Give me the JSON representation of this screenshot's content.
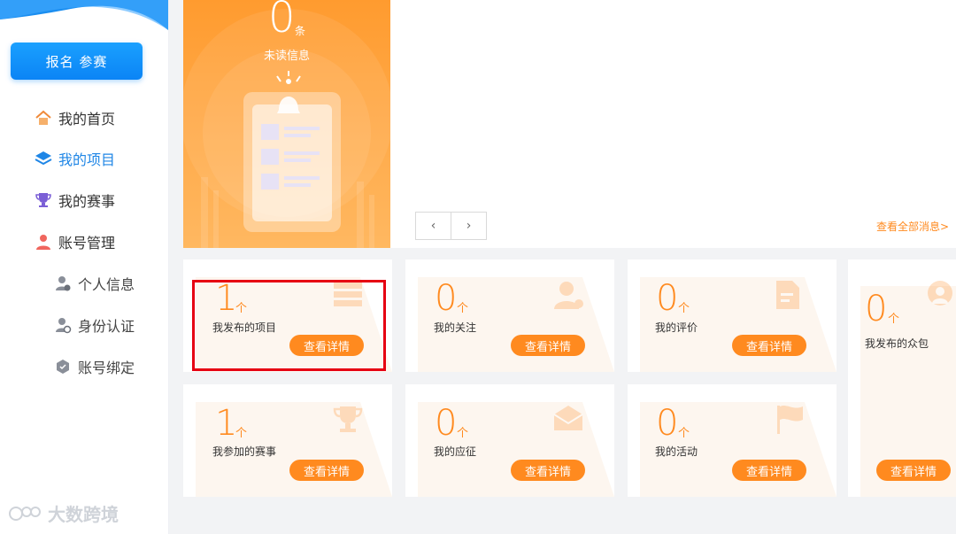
{
  "sidebar": {
    "signup_label": "报名 参赛",
    "items": [
      {
        "label": "我的首页",
        "icon": "home-icon"
      },
      {
        "label": "我的项目",
        "icon": "layers-icon",
        "active": true
      },
      {
        "label": "我的赛事",
        "icon": "trophy-icon"
      },
      {
        "label": "账号管理",
        "icon": "user-icon"
      }
    ],
    "sub_items": [
      {
        "label": "个人信息",
        "icon": "person-info-icon"
      },
      {
        "label": "身份认证",
        "icon": "id-verify-icon"
      },
      {
        "label": "账号绑定",
        "icon": "bind-icon"
      }
    ],
    "watermark": "大数跨境"
  },
  "notice": {
    "count": "0",
    "unit": "条",
    "label": "未读信息"
  },
  "messages": {
    "prev": "‹",
    "next": "›",
    "view_all": "查看全部消息>"
  },
  "cards": [
    {
      "count": "1",
      "unit": "个",
      "label": "我发布的项目",
      "button": "查看详情",
      "icon": "list-icon"
    },
    {
      "count": "0",
      "unit": "个",
      "label": "我的关注",
      "button": "查看详情",
      "icon": "user-star-icon"
    },
    {
      "count": "0",
      "unit": "个",
      "label": "我的评价",
      "button": "查看详情",
      "icon": "document-edit-icon"
    },
    {
      "count": "0",
      "unit": "个",
      "label": "我发布的众包",
      "button": "查看详情",
      "icon": "cloud-user-icon"
    },
    {
      "count": "1",
      "unit": "个",
      "label": "我参加的赛事",
      "button": "查看详情",
      "icon": "trophy-icon"
    },
    {
      "count": "0",
      "unit": "个",
      "label": "我的应征",
      "button": "查看详情",
      "icon": "mail-icon"
    },
    {
      "count": "0",
      "unit": "个",
      "label": "我的活动",
      "button": "查看详情",
      "icon": "flag-icon"
    }
  ],
  "colors": {
    "accent": "#ff8a1f",
    "primary": "#1f86e6",
    "highlight": "#e60012"
  }
}
